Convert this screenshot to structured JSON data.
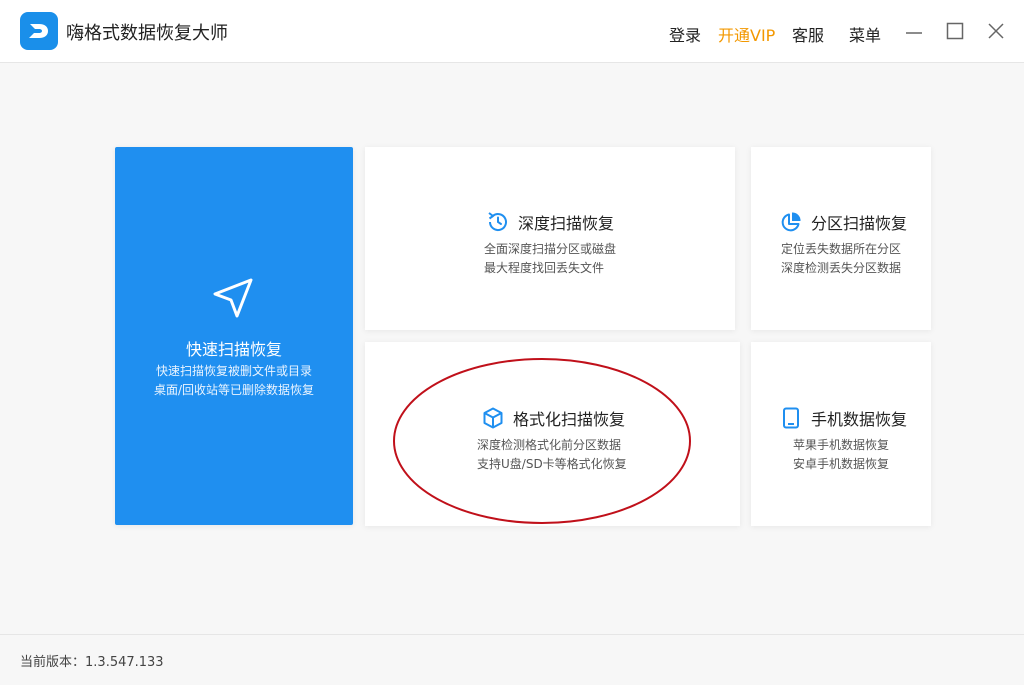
{
  "header": {
    "app_title": "嗨格式数据恢复大师",
    "login": "登录",
    "vip": "开通VIP",
    "service": "客服",
    "menu": "菜单"
  },
  "cards": {
    "quick": {
      "title": "快速扫描恢复",
      "desc_line1": "快速扫描恢复被删文件或目录",
      "desc_line2": "桌面/回收站等已删除数据恢复",
      "icon": "navigation-arrow-icon"
    },
    "deep": {
      "title": "深度扫描恢复",
      "desc_line1": "全面深度扫描分区或磁盘",
      "desc_line2": "最大程度找回丢失文件",
      "icon": "history-icon"
    },
    "partition": {
      "title": "分区扫描恢复",
      "desc_line1": "定位丢失数据所在分区",
      "desc_line2": "深度检测丢失分区数据",
      "icon": "pie-chart-icon"
    },
    "format": {
      "title": "格式化扫描恢复",
      "desc_line1": "深度检测格式化前分区数据",
      "desc_line2": "支持U盘/SD卡等格式化恢复",
      "icon": "cube-icon"
    },
    "phone": {
      "title": "手机数据恢复",
      "desc_line1": "苹果手机数据恢复",
      "desc_line2": "安卓手机数据恢复",
      "icon": "phone-icon"
    }
  },
  "footer": {
    "version_label": "当前版本：",
    "version_value": "1.3.547.133"
  },
  "colors": {
    "accent": "#1f8ff0",
    "vip": "#f39800",
    "annotation": "#c0101a"
  }
}
